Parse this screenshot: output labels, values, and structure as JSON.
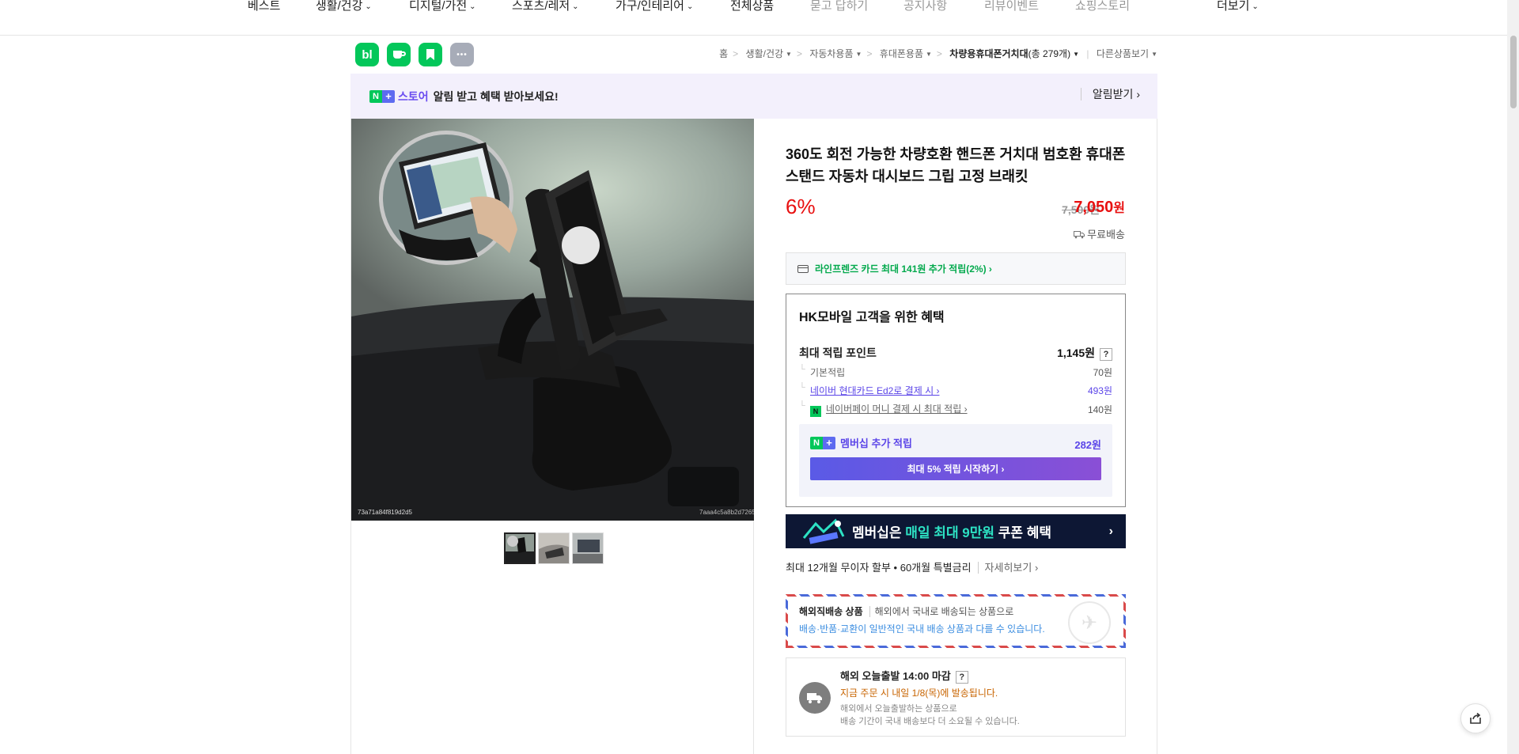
{
  "nav": {
    "items": [
      {
        "label": "베스트",
        "has_chevron": false,
        "muted": false
      },
      {
        "label": "생활/건강",
        "has_chevron": true,
        "muted": false
      },
      {
        "label": "디지털/가전",
        "has_chevron": true,
        "muted": false
      },
      {
        "label": "스포츠/레저",
        "has_chevron": true,
        "muted": false
      },
      {
        "label": "가구/인테리어",
        "has_chevron": true,
        "muted": false
      },
      {
        "label": "전체상품",
        "has_chevron": false,
        "muted": false
      },
      {
        "label": "묻고 답하기",
        "has_chevron": false,
        "muted": true
      },
      {
        "label": "공지사항",
        "has_chevron": false,
        "muted": true
      },
      {
        "label": "리뷰이벤트",
        "has_chevron": false,
        "muted": true
      },
      {
        "label": "쇼핑스토리",
        "has_chevron": false,
        "muted": true
      }
    ],
    "more_label": "더보기"
  },
  "sns": {
    "blog_label": "bl",
    "more_label": "•••"
  },
  "breadcrumb": {
    "home": "홈",
    "items": [
      "생활/건강",
      "자동차용품",
      "휴대폰용품"
    ],
    "current": "차량용휴대폰거치대",
    "count": "(총 279개)",
    "other": "다른상품보기"
  },
  "alarm": {
    "badge_n": "N",
    "badge_plus": "+",
    "store_label": "스토어",
    "message": "알림 받고 혜택 받아보세요!",
    "button": "알림받기 ›"
  },
  "product": {
    "title": "360도 회전 가능한 차량호환 핸드폰 거치대 범호환 휴대폰 스탠드 자동차 대시보드 그립 고정 브래킷",
    "discount": "6%",
    "original_price": "7,500원",
    "price_number": "7,050",
    "price_unit": "원",
    "shipping": "무료배송",
    "watermark_left": "73a71a84f819d2d5",
    "watermark_right": "7aaa4c5a8b2d7265"
  },
  "card_benefit": "라인프렌즈 카드 최대 141원 추가 적립(2%) ›",
  "benefit": {
    "heading": "HK모바일 고객을 위한 혜택",
    "max_point_label": "최대 적립 포인트",
    "max_point_value": "1,145원",
    "q_mark": "?",
    "rows": [
      {
        "label": "기본적립",
        "value": "70원"
      },
      {
        "label": "네이버 현대카드 Ed2로 결제 시 ›",
        "value": "493원"
      },
      {
        "label": "네이버페이 머니 결제 시 최대 적립 ›",
        "value": "140원"
      }
    ],
    "npay_badge": "N",
    "membership_label": "멤버십 추가 적립",
    "membership_value": "282원",
    "membership_button": "최대 5% 적립 시작하기 ›"
  },
  "promo": {
    "prefix": "멤버십은 ",
    "highlight": "매일 최대 9만원",
    "suffix": " 쿠폰 혜택",
    "arrow": "›"
  },
  "installment": {
    "text": "최대 12개월 무이자 할부 • 60개월 특별금리",
    "more": "자세히보기 ›"
  },
  "overseas": {
    "title": "해외직배송 상품",
    "desc": "해외에서 국내로 배송되는 상품으로",
    "note": "배송·반품·교환이 일반적인 국내 배송 상품과 다를 수 있습니다."
  },
  "delivery": {
    "title": "해외 오늘출발 14:00 마감",
    "q_mark": "?",
    "eta": "지금 주문 시 내일 1/8(목)에 발송됩니다.",
    "note1": "해외에서 오늘출발하는 상품으로",
    "note2": "배송 기간이 국내 배송보다 더 소요될 수 있습니다."
  },
  "colors": {
    "accent_red": "#e81010",
    "naver_green": "#03c75a",
    "membership_purple": "#5b45e8"
  }
}
